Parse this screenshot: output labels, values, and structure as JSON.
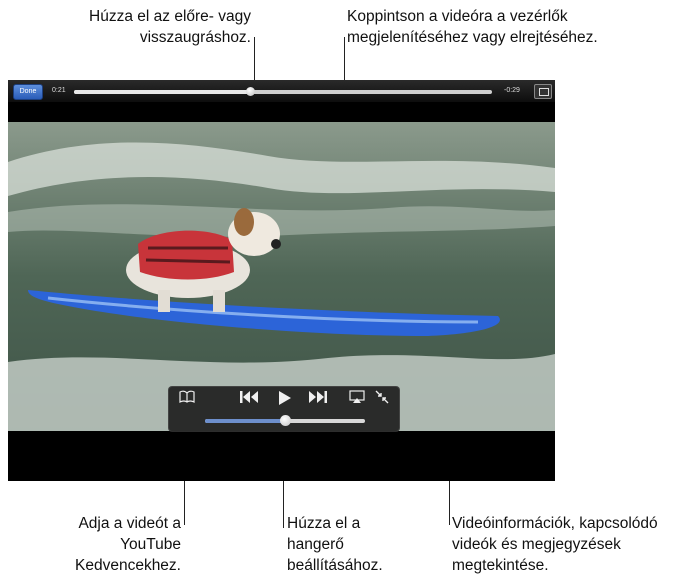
{
  "callouts": {
    "scrub_line1": "Húzza el az előre- vagy",
    "scrub_line2": "visszaugráshoz.",
    "tap_line1": "Koppintson a videóra a vezérlők",
    "tap_line2": "megjelenítéséhez vagy elrejtéséhez.",
    "fav_line1": "Adja a videót a",
    "fav_line2": "YouTube",
    "fav_line3": "Kedvencekhez.",
    "vol_line1": "Húzza el a",
    "vol_line2": "hangerő",
    "vol_line3": "beállításához.",
    "info_line1": "Videóinformációk, kapcsolódó",
    "info_line2": "videók és megjegyzések",
    "info_line3": "megtekintése."
  },
  "player": {
    "done_label": "Done",
    "elapsed": "0:21",
    "remaining": "-0:29",
    "playback_progress": 0.42,
    "volume_level": 0.5
  },
  "icons": {
    "bookmark": "open-book-icon",
    "previous": "skip-back-icon",
    "play": "play-icon",
    "next": "skip-forward-icon",
    "airplay": "airplay-icon",
    "minimize": "shrink-icon",
    "fit": "aspect-fit-icon"
  },
  "colors": {
    "done_button": "#3a6fd0",
    "volume_fill": "#6d8fcc",
    "letterbox": "#000000"
  }
}
